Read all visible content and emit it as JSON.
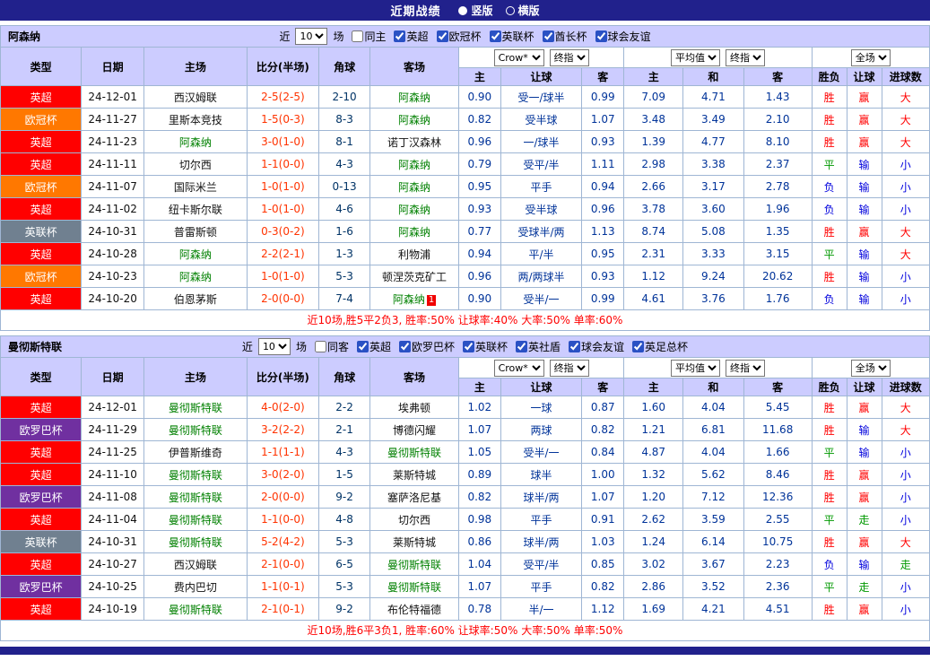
{
  "header": {
    "title": "近期战绩",
    "layout_options": [
      {
        "label": "竖版",
        "selected": true
      },
      {
        "label": "横版",
        "selected": false
      }
    ]
  },
  "table": {
    "main_columns": [
      "类型",
      "日期",
      "主场",
      "比分(半场)",
      "角球",
      "客场"
    ],
    "sub_columns": [
      "主",
      "让球",
      "客",
      "主",
      "和",
      "客",
      "胜负",
      "让球",
      "进球数"
    ],
    "selects": {
      "asia_company": "Crow*",
      "asia_time": "终指",
      "euro_company": "平均值",
      "euro_time": "终指",
      "scope": "全场"
    }
  },
  "colors": {
    "league": {
      "英超": "#ff0000",
      "欧冠杯": "#ff7800",
      "英联杯": "#708090",
      "欧罗巴杯": "#7030a0"
    },
    "result": {
      "r": "#ff0000",
      "g": "#009900",
      "b": "#0000dd"
    },
    "navy": "#21218c",
    "header_bg": "#ccccff",
    "team_highlight": "#008000",
    "score": "#ff3300"
  },
  "sections": [
    {
      "team": "阿森纳",
      "filter": {
        "near_label": "近",
        "count": "10",
        "games_label": "场",
        "venue": {
          "label": "同主",
          "checked": false
        },
        "leagues": [
          {
            "label": "英超",
            "checked": true
          },
          {
            "label": "欧冠杯",
            "checked": true
          },
          {
            "label": "英联杯",
            "checked": true
          },
          {
            "label": "酋长杯",
            "checked": true
          },
          {
            "label": "球会友谊",
            "checked": true
          }
        ]
      },
      "rows": [
        {
          "league": "英超",
          "date": "24-12-01",
          "home": "西汉姆联",
          "home_hl": false,
          "score": "2-5(2-5)",
          "corner": "2-10",
          "away": "阿森纳",
          "away_hl": true,
          "away_badge": "",
          "asia": [
            "0.90",
            "受一/球半",
            "0.99"
          ],
          "euro": [
            "7.09",
            "4.71",
            "1.43"
          ],
          "results": [
            {
              "t": "胜",
              "c": "r"
            },
            {
              "t": "赢",
              "c": "r"
            },
            {
              "t": "大",
              "c": "r"
            }
          ]
        },
        {
          "league": "欧冠杯",
          "date": "24-11-27",
          "home": "里斯本竞技",
          "home_hl": false,
          "score": "1-5(0-3)",
          "corner": "8-3",
          "away": "阿森纳",
          "away_hl": true,
          "away_badge": "",
          "asia": [
            "0.82",
            "受半球",
            "1.07"
          ],
          "euro": [
            "3.48",
            "3.49",
            "2.10"
          ],
          "results": [
            {
              "t": "胜",
              "c": "r"
            },
            {
              "t": "赢",
              "c": "r"
            },
            {
              "t": "大",
              "c": "r"
            }
          ]
        },
        {
          "league": "英超",
          "date": "24-11-23",
          "home": "阿森纳",
          "home_hl": true,
          "score": "3-0(1-0)",
          "corner": "8-1",
          "away": "诺丁汉森林",
          "away_hl": false,
          "away_badge": "",
          "asia": [
            "0.96",
            "一/球半",
            "0.93"
          ],
          "euro": [
            "1.39",
            "4.77",
            "8.10"
          ],
          "results": [
            {
              "t": "胜",
              "c": "r"
            },
            {
              "t": "赢",
              "c": "r"
            },
            {
              "t": "大",
              "c": "r"
            }
          ]
        },
        {
          "league": "英超",
          "date": "24-11-11",
          "home": "切尔西",
          "home_hl": false,
          "score": "1-1(0-0)",
          "corner": "4-3",
          "away": "阿森纳",
          "away_hl": true,
          "away_badge": "",
          "asia": [
            "0.79",
            "受平/半",
            "1.11"
          ],
          "euro": [
            "2.98",
            "3.38",
            "2.37"
          ],
          "results": [
            {
              "t": "平",
              "c": "g"
            },
            {
              "t": "输",
              "c": "b"
            },
            {
              "t": "小",
              "c": "b"
            }
          ]
        },
        {
          "league": "欧冠杯",
          "date": "24-11-07",
          "home": "国际米兰",
          "home_hl": false,
          "score": "1-0(1-0)",
          "corner": "0-13",
          "away": "阿森纳",
          "away_hl": true,
          "away_badge": "",
          "asia": [
            "0.95",
            "平手",
            "0.94"
          ],
          "euro": [
            "2.66",
            "3.17",
            "2.78"
          ],
          "results": [
            {
              "t": "负",
              "c": "b"
            },
            {
              "t": "输",
              "c": "b"
            },
            {
              "t": "小",
              "c": "b"
            }
          ]
        },
        {
          "league": "英超",
          "date": "24-11-02",
          "home": "纽卡斯尔联",
          "home_hl": false,
          "score": "1-0(1-0)",
          "corner": "4-6",
          "away": "阿森纳",
          "away_hl": true,
          "away_badge": "",
          "asia": [
            "0.93",
            "受半球",
            "0.96"
          ],
          "euro": [
            "3.78",
            "3.60",
            "1.96"
          ],
          "results": [
            {
              "t": "负",
              "c": "b"
            },
            {
              "t": "输",
              "c": "b"
            },
            {
              "t": "小",
              "c": "b"
            }
          ]
        },
        {
          "league": "英联杯",
          "date": "24-10-31",
          "home": "普雷斯顿",
          "home_hl": false,
          "score": "0-3(0-2)",
          "corner": "1-6",
          "away": "阿森纳",
          "away_hl": true,
          "away_badge": "",
          "asia": [
            "0.77",
            "受球半/两",
            "1.13"
          ],
          "euro": [
            "8.74",
            "5.08",
            "1.35"
          ],
          "results": [
            {
              "t": "胜",
              "c": "r"
            },
            {
              "t": "赢",
              "c": "r"
            },
            {
              "t": "大",
              "c": "r"
            }
          ]
        },
        {
          "league": "英超",
          "date": "24-10-28",
          "home": "阿森纳",
          "home_hl": true,
          "score": "2-2(2-1)",
          "corner": "1-3",
          "away": "利物浦",
          "away_hl": false,
          "away_badge": "",
          "asia": [
            "0.94",
            "平/半",
            "0.95"
          ],
          "euro": [
            "2.31",
            "3.33",
            "3.15"
          ],
          "results": [
            {
              "t": "平",
              "c": "g"
            },
            {
              "t": "输",
              "c": "b"
            },
            {
              "t": "大",
              "c": "r"
            }
          ]
        },
        {
          "league": "欧冠杯",
          "date": "24-10-23",
          "home": "阿森纳",
          "home_hl": true,
          "score": "1-0(1-0)",
          "corner": "5-3",
          "away": "顿涅茨克矿工",
          "away_hl": false,
          "away_badge": "",
          "asia": [
            "0.96",
            "两/两球半",
            "0.93"
          ],
          "euro": [
            "1.12",
            "9.24",
            "20.62"
          ],
          "results": [
            {
              "t": "胜",
              "c": "r"
            },
            {
              "t": "输",
              "c": "b"
            },
            {
              "t": "小",
              "c": "b"
            }
          ]
        },
        {
          "league": "英超",
          "date": "24-10-20",
          "home": "伯恩茅斯",
          "home_hl": false,
          "score": "2-0(0-0)",
          "corner": "7-4",
          "away": "阿森纳",
          "away_hl": true,
          "away_badge": "1",
          "asia": [
            "0.90",
            "受半/一",
            "0.99"
          ],
          "euro": [
            "4.61",
            "3.76",
            "1.76"
          ],
          "results": [
            {
              "t": "负",
              "c": "b"
            },
            {
              "t": "输",
              "c": "b"
            },
            {
              "t": "小",
              "c": "b"
            }
          ]
        }
      ],
      "summary": "近10场,胜5平2负3, 胜率:50% 让球率:40% 大率:50% 单率:60%"
    },
    {
      "team": "曼彻斯特联",
      "filter": {
        "near_label": "近",
        "count": "10",
        "games_label": "场",
        "venue": {
          "label": "同客",
          "checked": false
        },
        "leagues": [
          {
            "label": "英超",
            "checked": true
          },
          {
            "label": "欧罗巴杯",
            "checked": true
          },
          {
            "label": "英联杯",
            "checked": true
          },
          {
            "label": "英社盾",
            "checked": true
          },
          {
            "label": "球会友谊",
            "checked": true
          },
          {
            "label": "英足总杯",
            "checked": true
          }
        ]
      },
      "rows": [
        {
          "league": "英超",
          "date": "24-12-01",
          "home": "曼彻斯特联",
          "home_hl": true,
          "score": "4-0(2-0)",
          "corner": "2-2",
          "away": "埃弗顿",
          "away_hl": false,
          "away_badge": "",
          "asia": [
            "1.02",
            "一球",
            "0.87"
          ],
          "euro": [
            "1.60",
            "4.04",
            "5.45"
          ],
          "results": [
            {
              "t": "胜",
              "c": "r"
            },
            {
              "t": "赢",
              "c": "r"
            },
            {
              "t": "大",
              "c": "r"
            }
          ]
        },
        {
          "league": "欧罗巴杯",
          "date": "24-11-29",
          "home": "曼彻斯特联",
          "home_hl": true,
          "score": "3-2(2-2)",
          "corner": "2-1",
          "away": "博德闪耀",
          "away_hl": false,
          "away_badge": "",
          "asia": [
            "1.07",
            "两球",
            "0.82"
          ],
          "euro": [
            "1.21",
            "6.81",
            "11.68"
          ],
          "results": [
            {
              "t": "胜",
              "c": "r"
            },
            {
              "t": "输",
              "c": "b"
            },
            {
              "t": "大",
              "c": "r"
            }
          ]
        },
        {
          "league": "英超",
          "date": "24-11-25",
          "home": "伊普斯维奇",
          "home_hl": false,
          "score": "1-1(1-1)",
          "corner": "4-3",
          "away": "曼彻斯特联",
          "away_hl": true,
          "away_badge": "",
          "asia": [
            "1.05",
            "受半/一",
            "0.84"
          ],
          "euro": [
            "4.87",
            "4.04",
            "1.66"
          ],
          "results": [
            {
              "t": "平",
              "c": "g"
            },
            {
              "t": "输",
              "c": "b"
            },
            {
              "t": "小",
              "c": "b"
            }
          ]
        },
        {
          "league": "英超",
          "date": "24-11-10",
          "home": "曼彻斯特联",
          "home_hl": true,
          "score": "3-0(2-0)",
          "corner": "1-5",
          "away": "莱斯特城",
          "away_hl": false,
          "away_badge": "",
          "asia": [
            "0.89",
            "球半",
            "1.00"
          ],
          "euro": [
            "1.32",
            "5.62",
            "8.46"
          ],
          "results": [
            {
              "t": "胜",
              "c": "r"
            },
            {
              "t": "赢",
              "c": "r"
            },
            {
              "t": "小",
              "c": "b"
            }
          ]
        },
        {
          "league": "欧罗巴杯",
          "date": "24-11-08",
          "home": "曼彻斯特联",
          "home_hl": true,
          "score": "2-0(0-0)",
          "corner": "9-2",
          "away": "塞萨洛尼基",
          "away_hl": false,
          "away_badge": "",
          "asia": [
            "0.82",
            "球半/两",
            "1.07"
          ],
          "euro": [
            "1.20",
            "7.12",
            "12.36"
          ],
          "results": [
            {
              "t": "胜",
              "c": "r"
            },
            {
              "t": "赢",
              "c": "r"
            },
            {
              "t": "小",
              "c": "b"
            }
          ]
        },
        {
          "league": "英超",
          "date": "24-11-04",
          "home": "曼彻斯特联",
          "home_hl": true,
          "score": "1-1(0-0)",
          "corner": "4-8",
          "away": "切尔西",
          "away_hl": false,
          "away_badge": "",
          "asia": [
            "0.98",
            "平手",
            "0.91"
          ],
          "euro": [
            "2.62",
            "3.59",
            "2.55"
          ],
          "results": [
            {
              "t": "平",
              "c": "g"
            },
            {
              "t": "走",
              "c": "g"
            },
            {
              "t": "小",
              "c": "b"
            }
          ]
        },
        {
          "league": "英联杯",
          "date": "24-10-31",
          "home": "曼彻斯特联",
          "home_hl": true,
          "score": "5-2(4-2)",
          "corner": "5-3",
          "away": "莱斯特城",
          "away_hl": false,
          "away_badge": "",
          "asia": [
            "0.86",
            "球半/两",
            "1.03"
          ],
          "euro": [
            "1.24",
            "6.14",
            "10.75"
          ],
          "results": [
            {
              "t": "胜",
              "c": "r"
            },
            {
              "t": "赢",
              "c": "r"
            },
            {
              "t": "大",
              "c": "r"
            }
          ]
        },
        {
          "league": "英超",
          "date": "24-10-27",
          "home": "西汉姆联",
          "home_hl": false,
          "score": "2-1(0-0)",
          "corner": "6-5",
          "away": "曼彻斯特联",
          "away_hl": true,
          "away_badge": "",
          "asia": [
            "1.04",
            "受平/半",
            "0.85"
          ],
          "euro": [
            "3.02",
            "3.67",
            "2.23"
          ],
          "results": [
            {
              "t": "负",
              "c": "b"
            },
            {
              "t": "输",
              "c": "b"
            },
            {
              "t": "走",
              "c": "g"
            }
          ]
        },
        {
          "league": "欧罗巴杯",
          "date": "24-10-25",
          "home": "费内巴切",
          "home_hl": false,
          "score": "1-1(0-1)",
          "corner": "5-3",
          "away": "曼彻斯特联",
          "away_hl": true,
          "away_badge": "",
          "asia": [
            "1.07",
            "平手",
            "0.82"
          ],
          "euro": [
            "2.86",
            "3.52",
            "2.36"
          ],
          "results": [
            {
              "t": "平",
              "c": "g"
            },
            {
              "t": "走",
              "c": "g"
            },
            {
              "t": "小",
              "c": "b"
            }
          ]
        },
        {
          "league": "英超",
          "date": "24-10-19",
          "home": "曼彻斯特联",
          "home_hl": true,
          "score": "2-1(0-1)",
          "corner": "9-2",
          "away": "布伦特福德",
          "away_hl": false,
          "away_badge": "",
          "asia": [
            "0.78",
            "半/一",
            "1.12"
          ],
          "euro": [
            "1.69",
            "4.21",
            "4.51"
          ],
          "results": [
            {
              "t": "胜",
              "c": "r"
            },
            {
              "t": "赢",
              "c": "r"
            },
            {
              "t": "小",
              "c": "b"
            }
          ]
        }
      ],
      "summary": "近10场,胜6平3负1, 胜率:60% 让球率:50% 大率:50% 单率:50%"
    }
  ]
}
